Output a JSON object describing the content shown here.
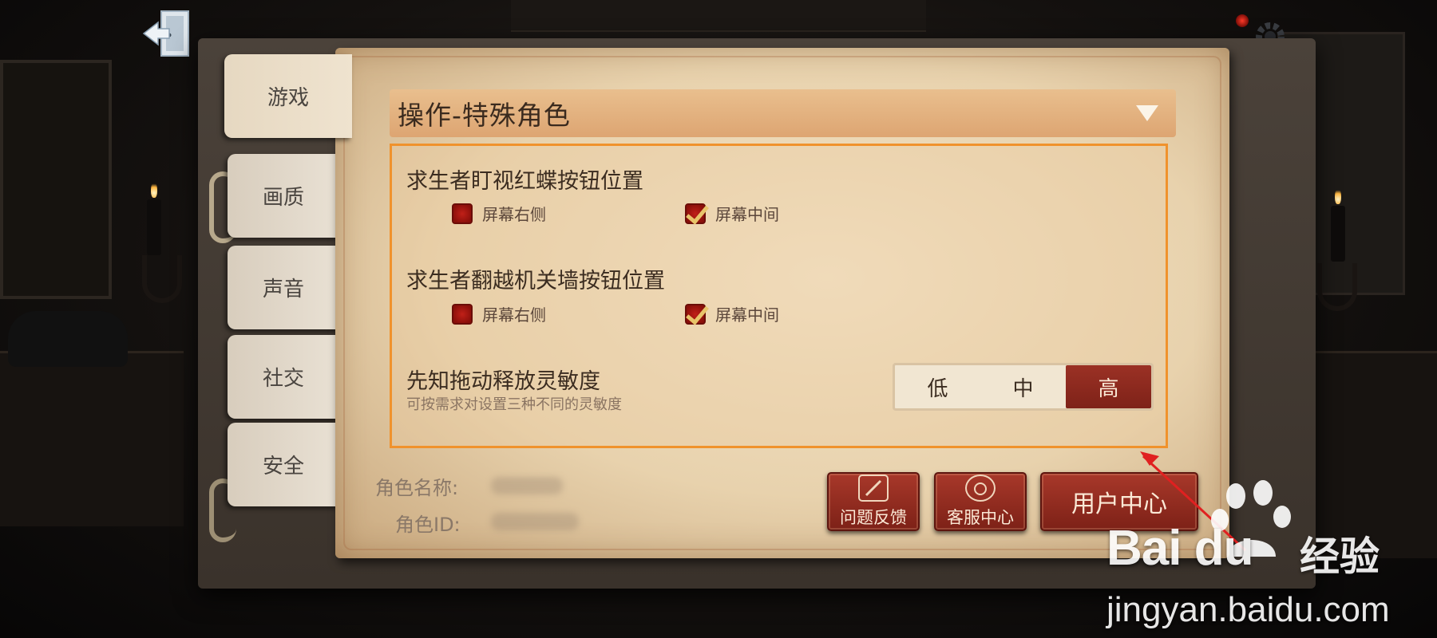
{
  "tabs": [
    {
      "label": "游戏",
      "active": true
    },
    {
      "label": "画质"
    },
    {
      "label": "声音"
    },
    {
      "label": "社交"
    },
    {
      "label": "安全"
    }
  ],
  "header": {
    "title": "操作-特殊角色"
  },
  "settings": [
    {
      "title": "求生者盯视红蝶按钮位置",
      "options": [
        {
          "label": "屏幕右侧",
          "checked": false
        },
        {
          "label": "屏幕中间",
          "checked": true
        }
      ]
    },
    {
      "title": "求生者翻越机关墙按钮位置",
      "options": [
        {
          "label": "屏幕右侧",
          "checked": false
        },
        {
          "label": "屏幕中间",
          "checked": true
        }
      ]
    },
    {
      "title": "先知拖动释放灵敏度",
      "subtitle": "可按需求对设置三种不同的灵敏度",
      "levels": [
        "低",
        "中",
        "高"
      ],
      "selected": "高"
    }
  ],
  "role": {
    "name_label": "角色名称:",
    "id_label": "角色ID:"
  },
  "buttons": {
    "feedback": "问题反馈",
    "service": "客服中心",
    "user_center": "用户中心"
  },
  "watermark": {
    "brand": "Bai du",
    "jingyan": "经验",
    "url": "jingyan.baidu.com"
  },
  "colors": {
    "highlight_border": "#f0922c",
    "button_red": "#8e2a1e",
    "annotation_arrow": "#e02020"
  }
}
